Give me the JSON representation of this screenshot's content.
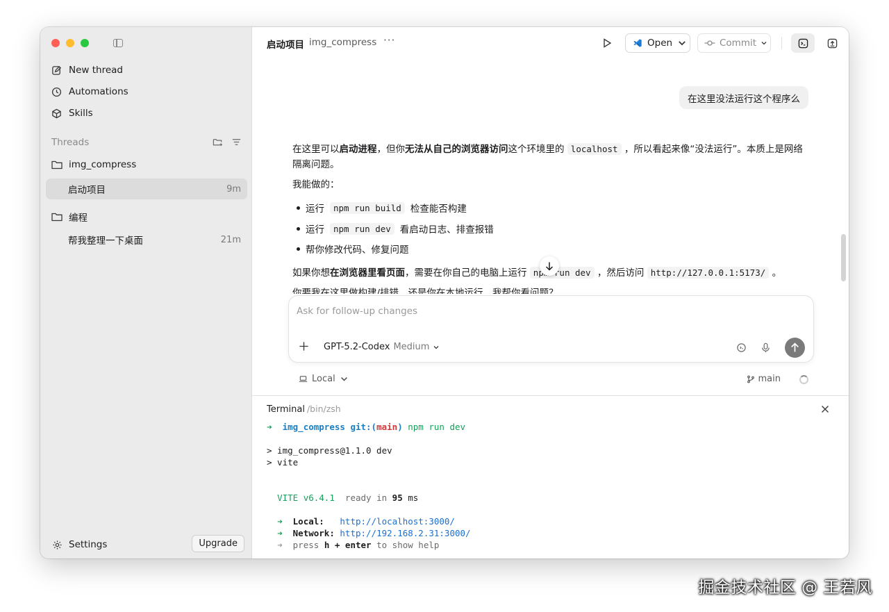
{
  "sidebar": {
    "nav": [
      {
        "label": "New thread",
        "icon": "edit-icon"
      },
      {
        "label": "Automations",
        "icon": "clock-icon"
      },
      {
        "label": "Skills",
        "icon": "cube-icon"
      }
    ],
    "threads_title": "Threads",
    "folders": [
      {
        "name": "img_compress",
        "items": [
          {
            "title": "启动项目",
            "time": "9m"
          }
        ]
      },
      {
        "name": "编程",
        "items": [
          {
            "title": "帮我整理一下桌面",
            "time": "21m"
          }
        ]
      }
    ],
    "settings_label": "Settings",
    "upgrade_label": "Upgrade"
  },
  "topbar": {
    "title": "启动项目",
    "project": "img_compress",
    "more": "···",
    "open_label": "Open",
    "commit_label": "Commit"
  },
  "chat": {
    "user_message": "在这里没法运行这个程序么",
    "p1_a": "在这里可以",
    "p1_b": "启动进程",
    "p1_c": "，但你",
    "p1_d": "无法从自己的浏览器访问",
    "p1_e": "这个环境里的",
    "p1_code": "localhost",
    "p1_f": "，所以看起来像“没法运行”。本质上是网络隔离问题。",
    "p2": "我能做的：",
    "bullets": [
      {
        "pre": "运行",
        "code": "npm run build",
        "post": "检查能否构建"
      },
      {
        "pre": "运行",
        "code": "npm run dev",
        "post": "看启动日志、排查报错"
      },
      {
        "pre": "帮你修改代码、修复问题",
        "code": "",
        "post": ""
      }
    ],
    "p3_a": "如果你想",
    "p3_b": "在浏览器里看页面",
    "p3_c": "，需要在你自己的电脑上运行",
    "p3_code1": "npm run dev",
    "p3_d": "，然后访问",
    "p3_code2": "http://127.0.0.1:5173/",
    "p3_e": "。",
    "p4": "你要我在这里做构建/排错，还是你在本地运行，我帮你看问题？"
  },
  "composer": {
    "placeholder": "Ask for follow-up changes",
    "model": "GPT-5.2-Codex",
    "level": "Medium",
    "env": "Local",
    "branch": "main"
  },
  "terminal": {
    "title": "Terminal",
    "shell": "/bin/zsh",
    "prompt_arrow": "➜",
    "prompt_dir": "img_compress",
    "prompt_git": "git:(",
    "prompt_branch": "main",
    "prompt_git_close": ")",
    "command": "npm run dev",
    "line_pkg": "> img_compress@1.1.0 dev",
    "line_vite": "> vite",
    "vite_name": "VITE v6.4.1",
    "ready_text": "ready in",
    "ready_ms": "95",
    "ready_unit": "ms",
    "local_label": "Local:",
    "local_url": "http://localhost:3000/",
    "network_label": "Network:",
    "network_url": "http://192.168.2.31:3000/",
    "help_pre": "press",
    "help_key": "h + enter",
    "help_post": "to show help"
  },
  "watermark": "掘金技术社区 @ 王若风"
}
